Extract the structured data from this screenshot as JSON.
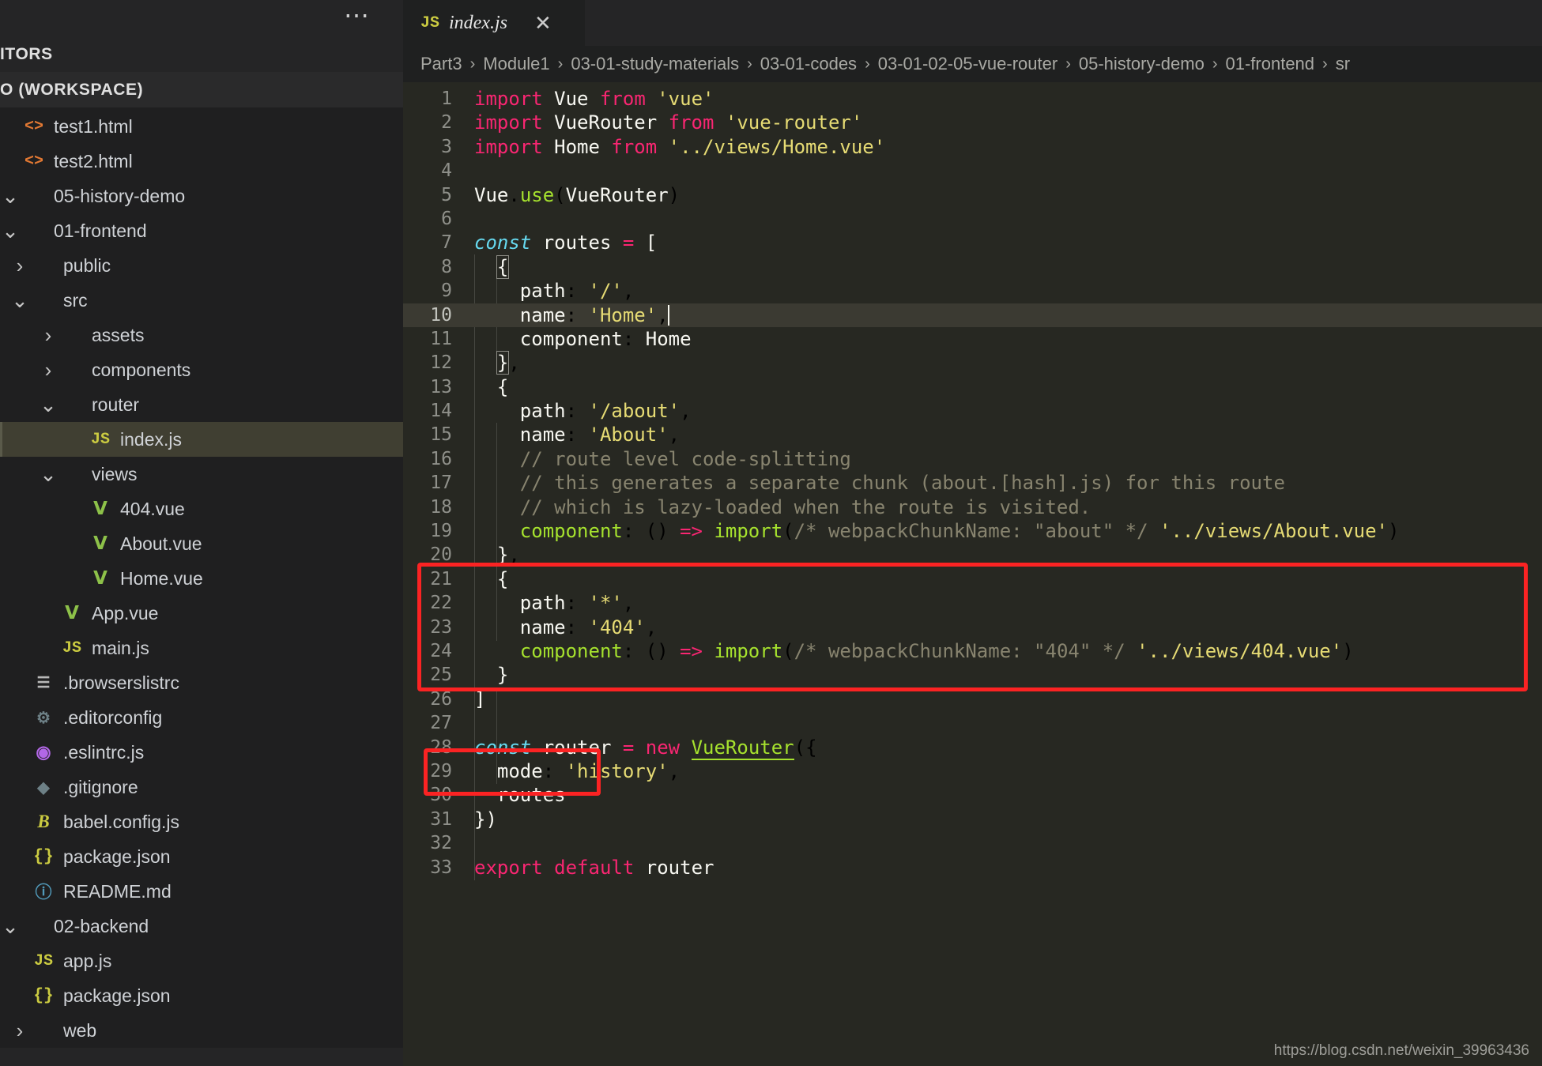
{
  "window": {
    "theme_bg": "#1e1e1e",
    "editor_bg": "#272822",
    "accent_annotation": "#fb2323"
  },
  "sidebar": {
    "more_actions_label": "…",
    "sections": [
      {
        "label": "ITORS",
        "full": "OPEN EDITORS"
      },
      {
        "label": "O (WORKSPACE)",
        "full": "UNTITLED (WORKSPACE)"
      }
    ],
    "items": [
      {
        "label": "test1.html",
        "icon": "html-icon",
        "chevron": "",
        "indent": 0
      },
      {
        "label": "test2.html",
        "icon": "html-icon",
        "chevron": "",
        "indent": 0
      },
      {
        "label": "05-history-demo",
        "icon": "folder-icon",
        "chevron": "v",
        "indent": 0
      },
      {
        "label": "01-frontend",
        "icon": "folder-icon",
        "chevron": "v",
        "indent": 1
      },
      {
        "label": "public",
        "icon": "folder-icon",
        "chevron": ">",
        "indent": 2
      },
      {
        "label": "src",
        "icon": "folder-icon",
        "chevron": "v",
        "indent": 2
      },
      {
        "label": "assets",
        "icon": "folder-icon",
        "chevron": ">",
        "indent": 3
      },
      {
        "label": "components",
        "icon": "folder-icon",
        "chevron": ">",
        "indent": 3
      },
      {
        "label": "router",
        "icon": "folder-icon",
        "chevron": "v",
        "indent": 3
      },
      {
        "label": "index.js",
        "icon": "js-icon",
        "chevron": "",
        "indent": 4,
        "selected": true
      },
      {
        "label": "views",
        "icon": "folder-icon",
        "chevron": "v",
        "indent": 3
      },
      {
        "label": "404.vue",
        "icon": "vue-icon",
        "chevron": "",
        "indent": 4
      },
      {
        "label": "About.vue",
        "icon": "vue-icon",
        "chevron": "",
        "indent": 4
      },
      {
        "label": "Home.vue",
        "icon": "vue-icon",
        "chevron": "",
        "indent": 4
      },
      {
        "label": "App.vue",
        "icon": "vue-icon",
        "chevron": "",
        "indent": 3
      },
      {
        "label": "main.js",
        "icon": "js-icon",
        "chevron": "",
        "indent": 3
      },
      {
        "label": ".browserslistrc",
        "icon": "list-icon",
        "chevron": "",
        "indent": 2
      },
      {
        "label": ".editorconfig",
        "icon": "gear-icon",
        "chevron": "",
        "indent": 2
      },
      {
        "label": ".eslintrc.js",
        "icon": "eslint-icon",
        "chevron": "",
        "indent": 2
      },
      {
        "label": ".gitignore",
        "icon": "git-icon",
        "chevron": "",
        "indent": 2
      },
      {
        "label": "babel.config.js",
        "icon": "babel-icon",
        "chevron": "",
        "indent": 2
      },
      {
        "label": "package.json",
        "icon": "json-icon",
        "chevron": "",
        "indent": 2
      },
      {
        "label": "README.md",
        "icon": "markdown-icon",
        "chevron": "",
        "indent": 2
      },
      {
        "label": "02-backend",
        "icon": "folder-icon",
        "chevron": "v",
        "indent": 1
      },
      {
        "label": "app.js",
        "icon": "js-icon",
        "chevron": "",
        "indent": 2
      },
      {
        "label": "package.json",
        "icon": "json-icon",
        "chevron": "",
        "indent": 2
      },
      {
        "label": "web",
        "icon": "folder-icon",
        "chevron": ">",
        "indent": 2
      }
    ]
  },
  "editor": {
    "tab": {
      "label": "index.js",
      "icon": "js-icon",
      "close_label": "✕"
    },
    "breadcrumb": [
      "Part3",
      "Module1",
      "03-01-study-materials",
      "03-01-codes",
      "03-01-02-05-vue-router",
      "05-history-demo",
      "01-frontend",
      "sr"
    ],
    "breadcrumb_separator": "›",
    "active_line": 10,
    "lines": [
      {
        "n": 1,
        "html": "<span class='t-key'>import</span> <span class='t-var'>Vue</span> <span class='t-key'>from</span> <span class='t-str'>'vue'</span>"
      },
      {
        "n": 2,
        "html": "<span class='t-key'>import</span> <span class='t-var'>VueRouter</span> <span class='t-key'>from</span> <span class='t-str'>'vue-router'</span>"
      },
      {
        "n": 3,
        "html": "<span class='t-key'>import</span> <span class='t-var'>Home</span> <span class='t-key'>from</span> <span class='t-str'>'../views/Home.vue'</span>"
      },
      {
        "n": 4,
        "html": ""
      },
      {
        "n": 5,
        "html": "<span class='t-var'>Vue</span>.<span class='t-fn'>use</span>(<span class='t-var'>VueRouter</span>)"
      },
      {
        "n": 6,
        "html": ""
      },
      {
        "n": 7,
        "html": "<span class='t-kw-it'>const</span> <span class='t-var'>routes</span> <span class='t-op'>=</span> <span class='t-var'>[</span>"
      },
      {
        "n": 8,
        "html": "  <span class='t-var bracket'>{</span>"
      },
      {
        "n": 9,
        "html": "    <span class='t-var'>path</span>: <span class='t-str'>'/'</span>,"
      },
      {
        "n": 10,
        "html": "    <span class='t-var'>name</span>: <span class='t-str'>'Home'</span>,<span class='cursor'></span>"
      },
      {
        "n": 11,
        "html": "    <span class='t-var'>component</span>: <span class='t-var'>Home</span>"
      },
      {
        "n": 12,
        "html": "  <span class='t-var bracket'>}</span>,"
      },
      {
        "n": 13,
        "html": "  <span class='t-var'>{</span>"
      },
      {
        "n": 14,
        "html": "    <span class='t-var'>path</span>: <span class='t-str'>'/about'</span>,"
      },
      {
        "n": 15,
        "html": "    <span class='t-var'>name</span>: <span class='t-str'>'About'</span>,"
      },
      {
        "n": 16,
        "html": "    <span class='t-com'>// route level code-splitting</span>"
      },
      {
        "n": 17,
        "html": "    <span class='t-com'>// this generates a separate chunk (about.[hash].js) for this route</span>"
      },
      {
        "n": 18,
        "html": "    <span class='t-com'>// which is lazy-loaded when the route is visited.</span>"
      },
      {
        "n": 19,
        "html": "    <span class='t-fn'>component</span>: () <span class='t-op'>=&gt;</span> <span class='t-fn'>import</span>(<span class='t-com'>/* webpackChunkName: \"about\" */</span> <span class='t-str'>'../views/About.vue'</span>)"
      },
      {
        "n": 20,
        "html": "  <span class='t-var'>}</span>,"
      },
      {
        "n": 21,
        "html": "  <span class='t-var'>{</span>"
      },
      {
        "n": 22,
        "html": "    <span class='t-var'>path</span>: <span class='t-str'>'*'</span>,"
      },
      {
        "n": 23,
        "html": "    <span class='t-var'>name</span>: <span class='t-str'>'404'</span>,"
      },
      {
        "n": 24,
        "html": "    <span class='t-fn'>component</span>: () <span class='t-op'>=&gt;</span> <span class='t-fn'>import</span>(<span class='t-com'>/* webpackChunkName: \"404\" */</span> <span class='t-str'>'../views/404.vue'</span>)"
      },
      {
        "n": 25,
        "html": "  <span class='t-var'>}</span>"
      },
      {
        "n": 26,
        "html": "<span class='t-var'>]</span>"
      },
      {
        "n": 27,
        "html": ""
      },
      {
        "n": 28,
        "html": "<span class='t-kw-it'>const</span> <span class='t-var'>router</span> <span class='t-op'>=</span> <span class='t-key'>new</span> <span class='t-fn t-ul'>VueRouter</span>({"
      },
      {
        "n": 29,
        "html": "  <span class='t-var'>mode</span>: <span class='t-str'>'history'</span>,"
      },
      {
        "n": 30,
        "html": "  <span class='t-var'>routes</span>"
      },
      {
        "n": 31,
        "html": "<span class='t-var'>})</span>"
      },
      {
        "n": 32,
        "html": ""
      },
      {
        "n": 33,
        "html": "<span class='t-key'>export</span> <span class='t-key'>default</span> <span class='t-var'>router</span>"
      }
    ],
    "annotations": [
      {
        "name": "annotation-box-404-route",
        "lines": "21-25",
        "color": "#fb2323"
      },
      {
        "name": "annotation-box-history-mode",
        "lines": "29",
        "color": "#fb2323"
      }
    ]
  },
  "watermark": {
    "text": "https://blog.csdn.net/weixin_39963436"
  }
}
